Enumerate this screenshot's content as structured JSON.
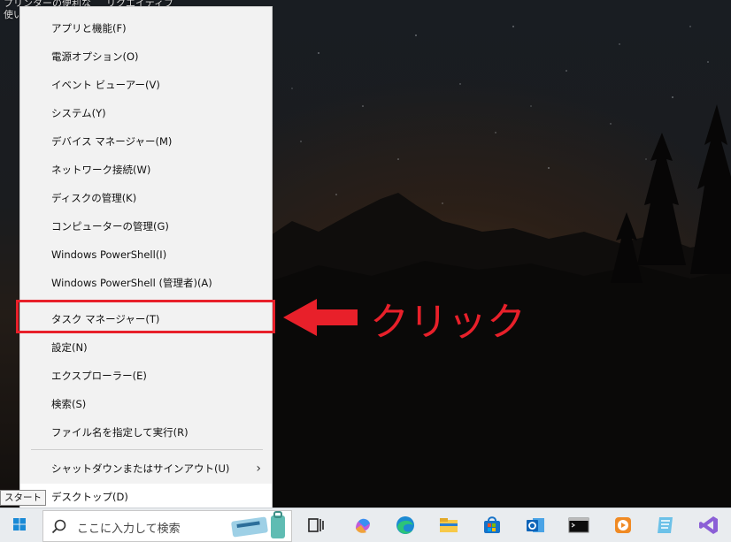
{
  "desktop": {
    "text_line1": "プリンターの便利な",
    "text_line1b": "リクエイティブ",
    "text_line2": "使い"
  },
  "menu": {
    "items": [
      {
        "label": "アプリと機能(F)"
      },
      {
        "label": "電源オプション(O)"
      },
      {
        "label": "イベント ビューアー(V)"
      },
      {
        "label": "システム(Y)"
      },
      {
        "label": "デバイス マネージャー(M)"
      },
      {
        "label": "ネットワーク接続(W)"
      },
      {
        "label": "ディスクの管理(K)"
      },
      {
        "label": "コンピューターの管理(G)"
      },
      {
        "label": "Windows PowerShell(I)"
      },
      {
        "label": "Windows PowerShell (管理者)(A)"
      },
      {
        "label": "タスク マネージャー(T)"
      },
      {
        "label": "設定(N)"
      },
      {
        "label": "エクスプローラー(E)"
      },
      {
        "label": "検索(S)"
      },
      {
        "label": "ファイル名を指定して実行(R)"
      },
      {
        "label": "シャットダウンまたはサインアウト(U)"
      },
      {
        "label": "デスクトップ(D)"
      }
    ],
    "submenu_arrow": "›"
  },
  "tooltip": {
    "label": "スタート"
  },
  "annotation": {
    "callout_text": "クリック",
    "color": "#e8202a"
  },
  "taskbar": {
    "search_placeholder": "ここに入力して検索",
    "icons": [
      "task-view-icon",
      "copilot-icon",
      "edge-icon",
      "file-explorer-icon",
      "store-icon",
      "outlook-icon",
      "terminal-icon",
      "media-player-icon",
      "notepad-icon",
      "visual-studio-icon"
    ]
  }
}
